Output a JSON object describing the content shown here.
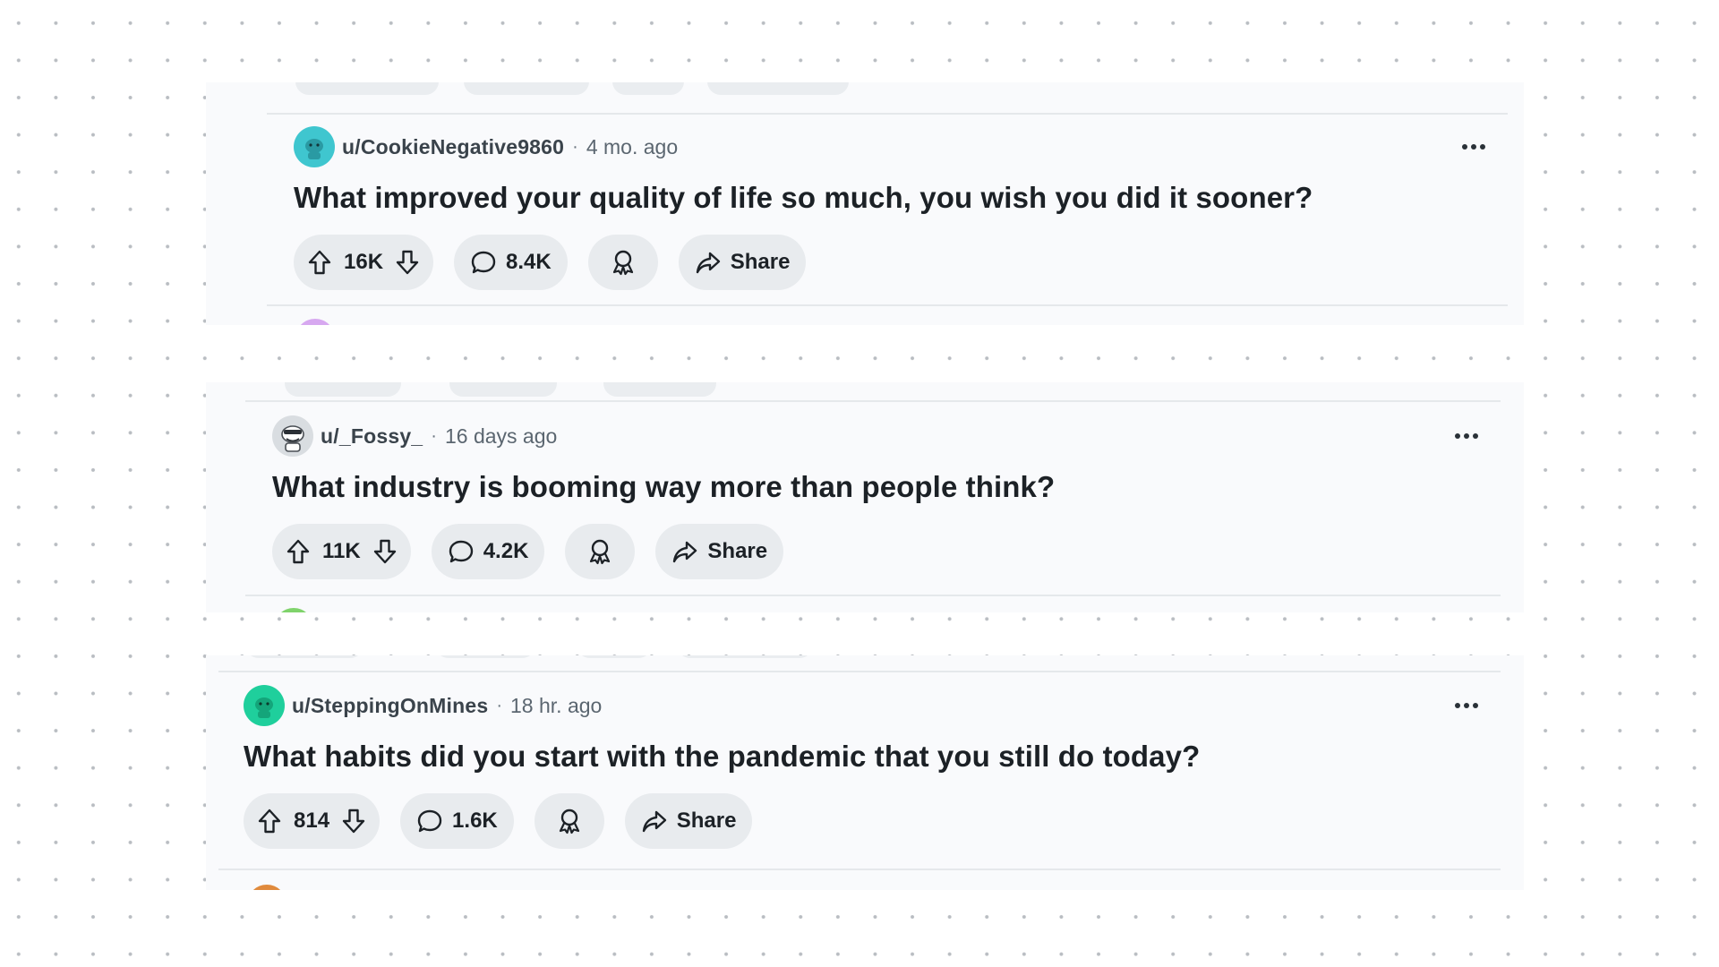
{
  "posts": [
    {
      "username": "u/CookieNegative9860",
      "separator": "·",
      "time": "4 mo. ago",
      "title": "What improved your quality of life so much, you wish you did it sooner?",
      "votes": "16K",
      "comments": "8.4K",
      "share_label": "Share",
      "avatar_color": "#3fc6cf"
    },
    {
      "username": "u/_Fossy_",
      "separator": "·",
      "time": "16 days ago",
      "title": "What industry is booming way more than people think?",
      "votes": "11K",
      "comments": "4.2K",
      "share_label": "Share",
      "avatar_color": "#d9dde1"
    },
    {
      "username": "u/SteppingOnMines",
      "separator": "·",
      "time": "18 hr. ago",
      "title": "What habits did you start with the pandemic that you still do today?",
      "votes": "814",
      "comments": "1.6K",
      "share_label": "Share",
      "avatar_color": "#1fcf9c"
    }
  ],
  "colors": {
    "card_background": "#f9fafc",
    "pill_background": "#e8ebee",
    "title_text": "#1c2126",
    "meta_text": "#5b6670",
    "dot_grid": "#b9bdc2"
  },
  "icons": {
    "upvote": "upvote-arrow-icon",
    "downvote": "downvote-arrow-icon",
    "comments": "speech-bubble-icon",
    "award": "award-ribbon-icon",
    "share": "share-arrow-icon",
    "more": "ellipsis-icon"
  }
}
